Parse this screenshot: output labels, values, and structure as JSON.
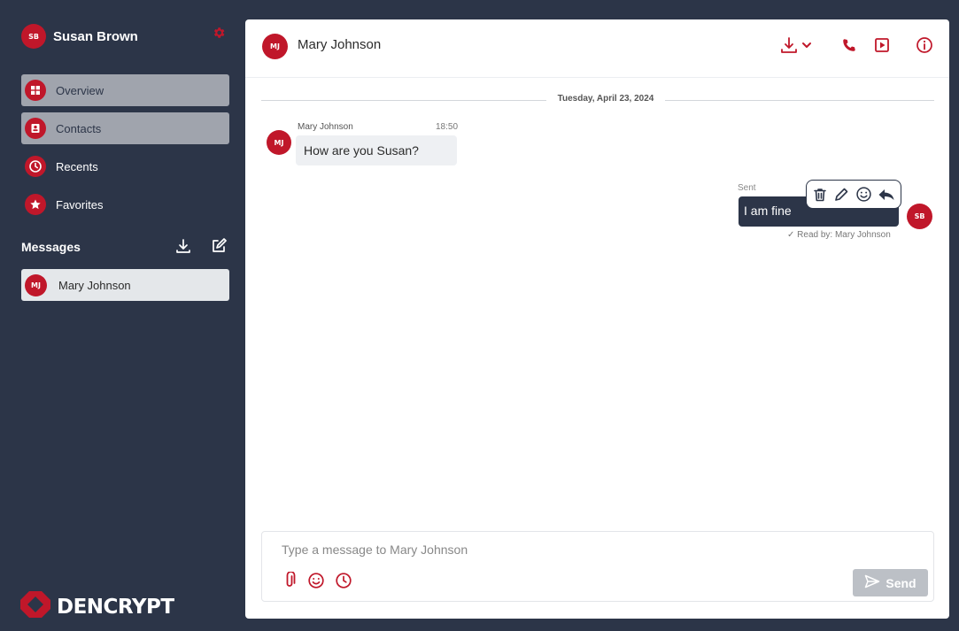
{
  "colors": {
    "accent": "#c0172a",
    "sidebar_bg": "#2c3548",
    "active_nav_bg": "#a0a4ad",
    "conversation_bg": "#e4e7ea",
    "send_disabled": "#bcc0c6"
  },
  "user": {
    "initials": "SB",
    "name": "Susan Brown",
    "settings_icon": "gear-icon"
  },
  "nav": [
    {
      "label": "Overview",
      "icon": "grid-icon",
      "active": true
    },
    {
      "label": "Contacts",
      "icon": "contact-card-icon",
      "active": true
    },
    {
      "label": "Recents",
      "icon": "clock-icon",
      "active": false
    },
    {
      "label": "Favorites",
      "icon": "star-icon",
      "active": false
    }
  ],
  "messages": {
    "heading": "Messages",
    "download_icon": "download-icon",
    "compose_icon": "compose-icon",
    "conversations": [
      {
        "initials": "MJ",
        "name": "Mary Johnson"
      }
    ]
  },
  "brand": {
    "name": "DENCRYPT"
  },
  "chat": {
    "contact_initials": "MJ",
    "contact_name": "Mary Johnson",
    "header_icons": [
      "download-dropdown-icon",
      "phone-icon",
      "video-icon",
      "info-icon"
    ],
    "date_divider": "Tuesday, April 23, 2024",
    "incoming": {
      "sender": "Mary Johnson",
      "time": "18:50",
      "text": "How are you Susan?"
    },
    "outgoing": {
      "status": "Sent",
      "text": "I am fine",
      "initials": "SB",
      "read_receipt": "Read by: Mary Johnson",
      "actions": [
        "delete-icon",
        "edit-icon",
        "emoji-icon",
        "reply-icon"
      ]
    }
  },
  "composer": {
    "placeholder": "Type a message to Mary Johnson",
    "value": "",
    "icons": [
      "attachment-icon",
      "emoji-icon",
      "clock-icon"
    ],
    "send_label": "Send"
  }
}
